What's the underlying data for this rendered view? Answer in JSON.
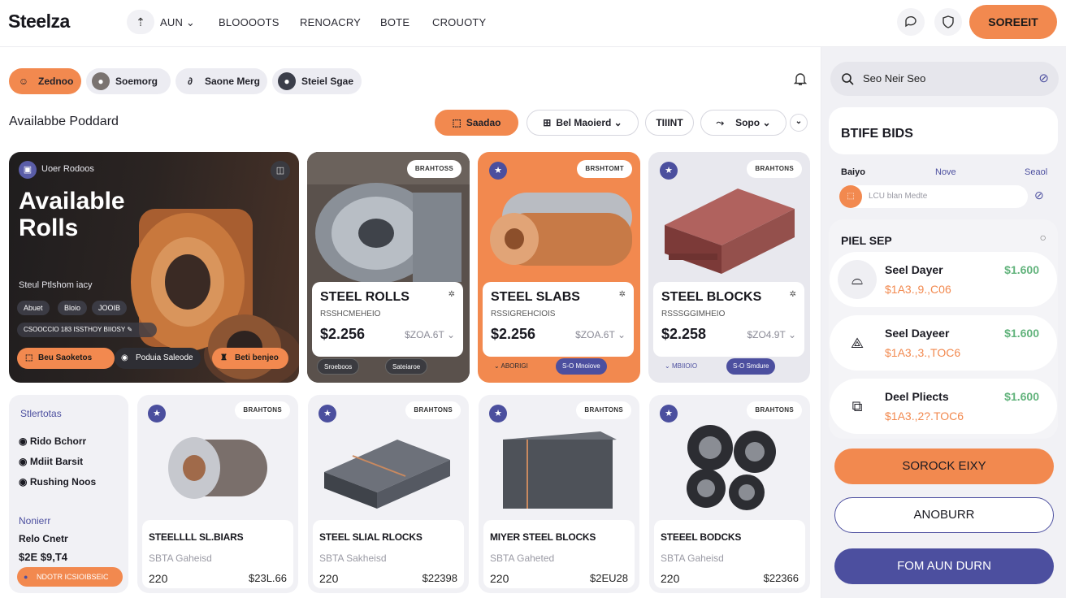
{
  "brand": "Steelza",
  "nav": {
    "items": [
      "AUN",
      "BLOOOOTS",
      "RENOACRY",
      "BOTE",
      "CROUOTY"
    ]
  },
  "header": {
    "cta": "SOREEIT"
  },
  "chips": [
    {
      "label": "Zednoo"
    },
    {
      "label": "Soemorg"
    },
    {
      "label": "Saone Merg"
    },
    {
      "label": "Steiel Sgae"
    }
  ],
  "section": {
    "title": "Availabbe Poddard"
  },
  "controls": {
    "primary": "Saadao",
    "material": "Bel Maoierd",
    "third": "TIIINT",
    "sort": "Sopo"
  },
  "hero": {
    "tag": "Uoer Rodoos",
    "title": "Available Rolls",
    "subtitle": "Steul Ptlshom iacy",
    "tags": [
      "Abuet",
      "Bloio",
      "JOOIB"
    ],
    "note": "CSOOCCIO 183 ISSTHOY BIIOSY",
    "buttons": [
      "Beu Saoketos",
      "Poduia Saleode",
      "Beti benjeo"
    ]
  },
  "products": [
    {
      "badge": "BRAHTOSS",
      "name": "STEEL ROLLS",
      "sub": "RSSHCMEHEIO",
      "price": "$2.256",
      "meta": "$ZOA.6T",
      "tags": [
        "Sroeboos",
        "Sateiaroe"
      ]
    },
    {
      "badge": "BRSHTOMT",
      "name": "STEEL SLABS",
      "sub": "RSSIGREHCIOIS",
      "price": "$2.256",
      "meta": "$ZOA.6T",
      "tags": [
        "ABORIGI",
        "S-O Mnoiove"
      ]
    },
    {
      "badge": "BRAHTONS",
      "name": "STEEL BLOCKS",
      "sub": "RSSSGGIMHEIO",
      "price": "$2.258",
      "meta": "$ZO4.9T",
      "tags": [
        "MBIIOIO",
        "S-O Smdure"
      ]
    }
  ],
  "filters": {
    "title": "Stlertotas",
    "options": [
      "Rido Bchorr",
      "Mdiit Barsit",
      "Rushing Noos"
    ],
    "label": "Nonierr",
    "sublabel": "Relo Cnetr",
    "price": "$2E $9,T4",
    "button": "NDOTR ICSIOIBSEIC"
  },
  "lower": [
    {
      "badge": "BRAHTONS",
      "name": "STEELLLL SL.BIARS",
      "sub": "SBTA Gaheisd",
      "qty": "220",
      "price": "$23L.66"
    },
    {
      "badge": "BRAHTONS",
      "name": "STEEL SLIAL RLOCKS",
      "sub": "SBTA Sakheisd",
      "qty": "220",
      "price": "$22398"
    },
    {
      "badge": "BRAHTONS",
      "name": "MIYER STEEL BLOCKS",
      "sub": "SBTA Gaheted",
      "qty": "220",
      "price": "$2EU28"
    },
    {
      "badge": "BRAHTONS",
      "name": "STEEEL BODCKS",
      "sub": "SBTA Gaheisd",
      "qty": "220",
      "price": "$22366"
    }
  ],
  "sidebar": {
    "search_placeholder": "Seo Neir Seo",
    "bids_title": "BTIFE BIDS",
    "tabs": [
      "Baiyo",
      "Nove",
      "Seaol"
    ],
    "bid_input": "LCU blan Medte",
    "section2": "PIEL SEP",
    "rows": [
      {
        "name": "Seel Dayer",
        "price": "$1.600",
        "sub": "$1A3.,9.,C06"
      },
      {
        "name": "Seel Dayeer",
        "price": "$1.600",
        "sub": "$1A3.,3.,TOC6"
      },
      {
        "name": "Deel Pliects",
        "price": "$1.600",
        "sub": "$1A3.,2?.TOC6"
      }
    ],
    "btn_primary": "SOROCK EIXY",
    "btn_secondary": "ANOBURR",
    "btn_tertiary": "FOM AUN DURN"
  },
  "colors": {
    "accent": "#f2894f",
    "indigo": "#4c4f9f",
    "green": "#62b37c"
  }
}
